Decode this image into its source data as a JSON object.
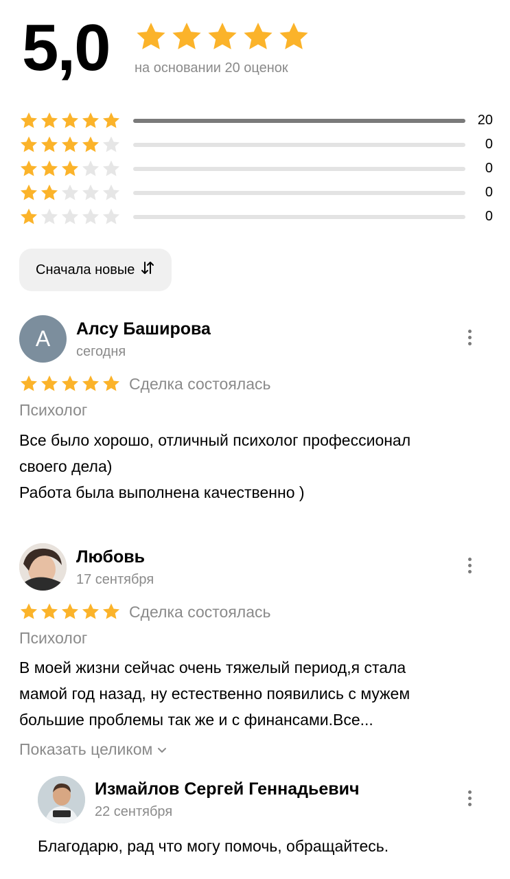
{
  "summary": {
    "score": "5,0",
    "based_on": "на основании 20 оценок",
    "rows": [
      {
        "stars": 5,
        "count": "20",
        "fraction": 1.0
      },
      {
        "stars": 4,
        "count": "0",
        "fraction": 0
      },
      {
        "stars": 3,
        "count": "0",
        "fraction": 0
      },
      {
        "stars": 2,
        "count": "0",
        "fraction": 0
      },
      {
        "stars": 1,
        "count": "0",
        "fraction": 0
      }
    ]
  },
  "sort": {
    "label": "Сначала новые",
    "icon": "sort-arrows-icon"
  },
  "reviews": [
    {
      "author": "Алсу Баширова",
      "initial": "А",
      "date": "сегодня",
      "rating": 5,
      "status": "Сделка состоялась",
      "category": "Психолог",
      "text": [
        "Все было хорошо, отличный психолог профессионал",
        "своего дела)",
        "Работа была выполнена качественно )"
      ]
    },
    {
      "author": "Любовь",
      "date": "17 сентября",
      "rating": 5,
      "status": "Сделка состоялась",
      "category": "Психолог",
      "text": [
        "В моей жизни сейчас очень тяжелый период,я стала",
        "мамой год назад, ну естественно появились с мужем",
        "большие проблемы так же и с финансами.Все..."
      ],
      "show_more": "Показать целиком"
    }
  ],
  "reply": {
    "author": "Измайлов Сергей Геннадьевич",
    "date": "22 сентября",
    "text": "Благодарю, рад что могу помочь, обращайтесь."
  },
  "colors": {
    "star": "#FBB32A",
    "star_empty": "#E6E6E6",
    "muted": "#8A8A8A",
    "avatar_a": "#7C8E9D"
  }
}
